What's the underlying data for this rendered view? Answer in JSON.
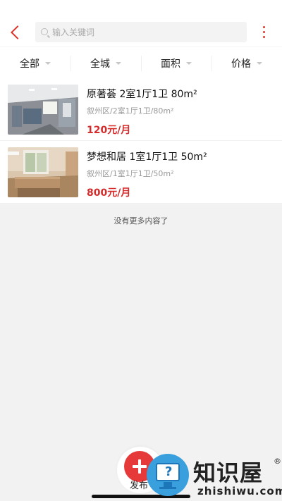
{
  "search": {
    "placeholder": "输入关键词",
    "value": ""
  },
  "filters": [
    {
      "label": "全部"
    },
    {
      "label": "全城"
    },
    {
      "label": "面积"
    },
    {
      "label": "价格"
    }
  ],
  "listings": [
    {
      "title": "原著荟 2室1厅1卫 80m²",
      "subtitle": "叙州区/2室1厅1卫/80m²",
      "price": "120元/月"
    },
    {
      "title": "梦想和居 1室1厅1卫 50m²",
      "subtitle": "叙州区/1室1厅1卫/50m²",
      "price": "800元/月"
    }
  ],
  "end_message": "没有更多内容了",
  "publish": {
    "label": "发布"
  },
  "watermark": {
    "name": "知识屋",
    "reg": "®",
    "url": "zhishiwu.com"
  },
  "colors": {
    "accent": "#d9342b",
    "price": "#d42b2b",
    "background": "#f2f2f2"
  }
}
